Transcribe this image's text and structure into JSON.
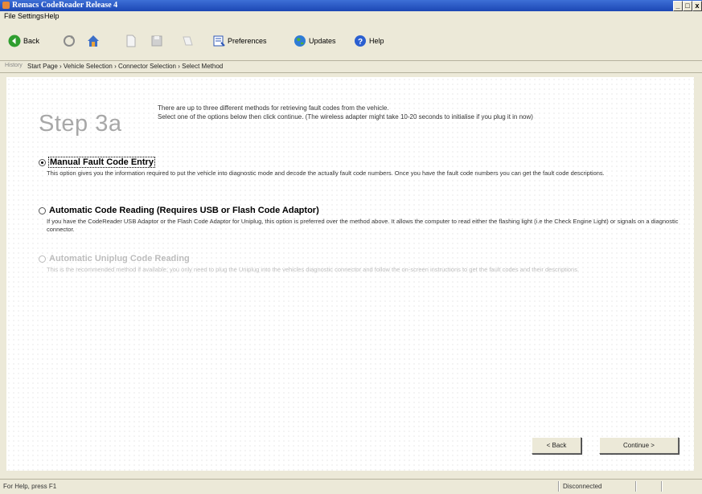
{
  "window": {
    "title": "Remacs CodeReader Release 4"
  },
  "window_controls": {
    "minimize": "_",
    "maximize": "□",
    "close": "x"
  },
  "menu": [
    "File",
    "Settings",
    "Help"
  ],
  "toolbar": {
    "back_label": "Back",
    "preferences_label": "Preferences",
    "updates_label": "Updates",
    "help_label": "Help"
  },
  "breadcrumb": {
    "label": "History",
    "items": "Start Page › Vehicle Selection › Connector Selection › Select Method"
  },
  "page": {
    "step_title": "Step 3a",
    "intro_line1": "There are up to three different methods for retrieving fault codes from the vehicle.",
    "intro_line2": "Select one of the options below then click continue. (The wireless adapter might take 10-20 seconds to initialise if you plug it in now)"
  },
  "options": [
    {
      "title": "Manual Fault Code Entry",
      "description": "This option gives you the information required to put the vehicle into diagnostic mode and decode the actually fault code numbers. Once you have the fault code numbers you can get the fault code descriptions.",
      "selected": true,
      "enabled": true
    },
    {
      "title": "Automatic Code Reading (Requires USB or Flash Code Adaptor)",
      "description": "If you have the CodeReader USB Adaptor or the Flash Code Adaptor for Uniplug, this option is preferred over the method above. It allows the computer to read either the flashing light (i.e the Check Engine Light) or signals on a diagnostic connector.",
      "selected": false,
      "enabled": true
    },
    {
      "title": "Automatic Uniplug Code Reading",
      "description": "This is the recommended method if available; you only need to plug the Uniplug into the vehicles diagnostic connector and follow the on-screen instructions to get the fault codes and their descriptions.",
      "selected": false,
      "enabled": false
    }
  ],
  "buttons": {
    "back": "< Back",
    "continue": "Continue >"
  },
  "status": {
    "hint": "For Help, press F1",
    "connection": "Disconnected"
  },
  "colors": {
    "titlebar": "#1c47b4",
    "window_bg": "#ece9d8",
    "disabled_text": "#bdbdbd"
  }
}
